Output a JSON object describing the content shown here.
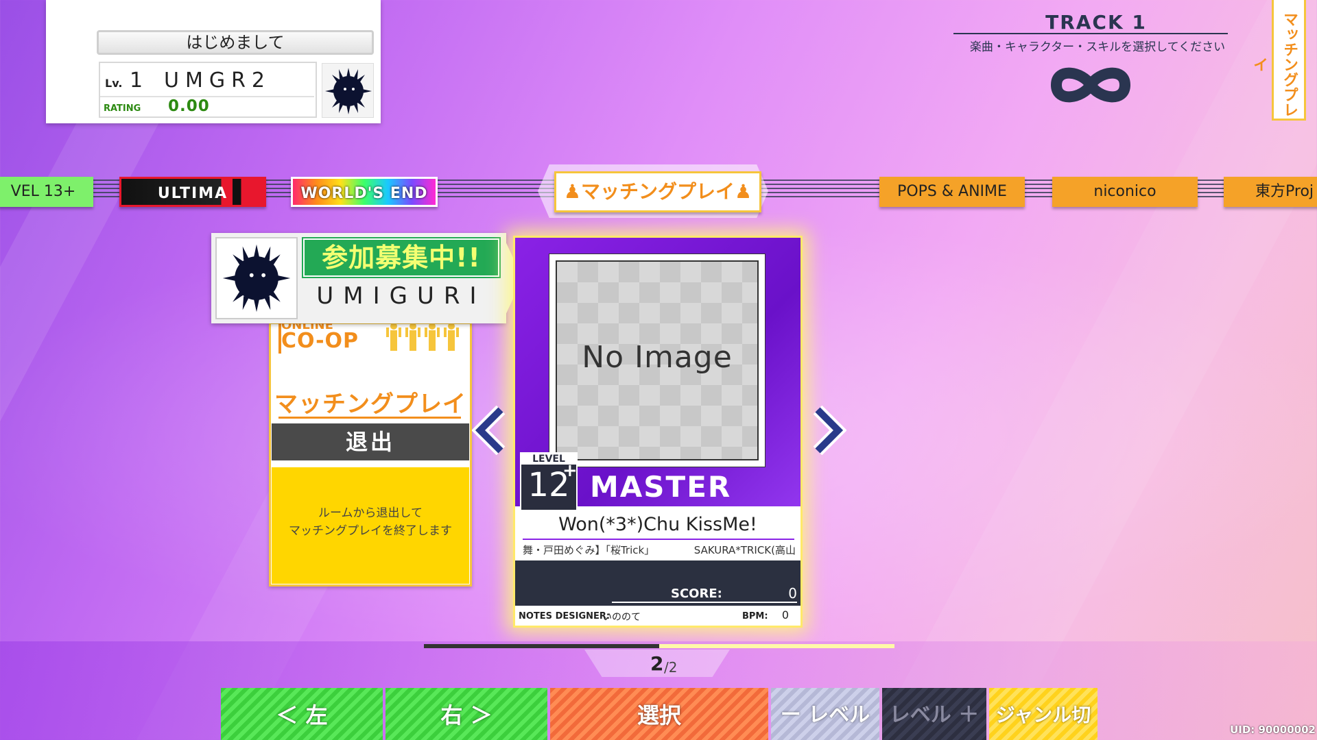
{
  "player": {
    "greeting": "はじめまして",
    "level_label": "Lv.",
    "level": "1",
    "name": "UMGR2",
    "rating_label": "RATING",
    "rating": "0.00"
  },
  "track": {
    "title": "TRACK 1",
    "subtitle": "楽曲・キャラクター・スキルを選択してください",
    "remaining_icon": "infinity-icon"
  },
  "side_tab": {
    "label": "マッチングプレイ"
  },
  "genres": {
    "level13": "VEL 13+",
    "ultima": "ULTIMA",
    "worlds_end": "WORLD'S END",
    "matching": "マッチングプレイ",
    "pops": "POPS & ANIME",
    "niconico": "niconico",
    "touhou": "東方Proj"
  },
  "host": {
    "status": "参加募集中!!",
    "name": "UMIGURI"
  },
  "exit_card": {
    "online": "ONLINE",
    "coop": "CO-OP",
    "mode_title": "マッチングプレイ",
    "button": "退出",
    "description_line1": "ルームから退出して",
    "description_line2": "マッチングプレイを終了します"
  },
  "song": {
    "jacket_text": "No Image",
    "level_label": "LEVEL",
    "level": "12",
    "level_plus": "+",
    "difficulty": "MASTER",
    "title": "Won(*3*)Chu KissMe!",
    "artist": "舞・戸田めぐみ】「桜Trick」",
    "composer": "SAKURA*TRICK(高山",
    "score_label": "SCORE:",
    "score": "0",
    "designer_label": "NOTES DESIGNER:",
    "designer": "いののて",
    "bpm_label": "BPM:",
    "bpm": "0"
  },
  "paging": {
    "current": "2",
    "total": "/2",
    "progress": 0.5
  },
  "bottom_buttons": {
    "left": "＜ 左",
    "right": "右 ＞",
    "select": "選択",
    "level_minus": "ー レベル",
    "level_plus": "レベル ＋",
    "genre_switch": "ジャンル切替"
  },
  "uid": "UID: 90000002",
  "colors": {
    "accent_orange": "#f28e1c",
    "accent_yellow": "#f6c53c",
    "master_purple": "#8a22e6",
    "recruit_green": "#23a955",
    "navy": "#2a3550"
  }
}
